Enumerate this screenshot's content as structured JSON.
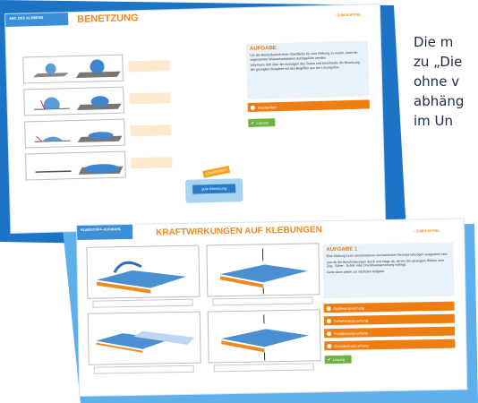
{
  "side_text": {
    "lines": [
      "Die m",
      "zu „Die",
      "ohne v",
      "abhäng",
      "im Un"
    ]
  },
  "slide1": {
    "tab_label": "ABC DES KLEBENS",
    "title": "BENETZUNG",
    "chapter_link": "› ZUM KAPITEL",
    "task": {
      "title": "AUFGABE",
      "text_1": "Um die Benetzbarkeit einer Oberfläche für eine Klebung zu testen, kann ein sogenannter Wasserkontakttest durchgeführt werden.",
      "text_2": "Informiere dich über die Aussagen des Testes und beschreibe die Benetzung der gezeigten Beispiele mit den Begriffen aus der Lösungsbox."
    },
    "option_label": "Randwinkel",
    "solution_label": "Lösung",
    "sticker_label": "LÖSUNGSBOX",
    "box_label": "gute Benetzung"
  },
  "slide2": {
    "tab_label": "KLEBSTOFF-AUSWAHL",
    "title": "KRAFTWIRKUNGEN AUF KLEBUNGEN",
    "chapter_link": "› ZUM KAPITEL",
    "task": {
      "title": "AUFGABE 1",
      "text_1": "Eine Klebung kann verschiedenen mechanischen Beanspruchungen ausgesetzt sein.",
      "text_2": "Lies dir die Beschreibungen durch und klage ab, ob bei den gezeigten Bildern eine Zug-, Scher-, Schäl- oder Druckbeanspruchung vorliegt.",
      "text_3": "Gehe dann weiter zur nächsten Aufgabe."
    },
    "options": [
      "Zugbeanspruchung",
      "Scherbeanspruchung",
      "Schälbeanspruchung",
      "Druckbeanspruchung"
    ],
    "solution_label": "Lösung"
  },
  "colors": {
    "accent_blue": "#1d73c6",
    "light_blue": "#5fb0ea",
    "orange": "#ee7d12",
    "green": "#6db33f"
  }
}
